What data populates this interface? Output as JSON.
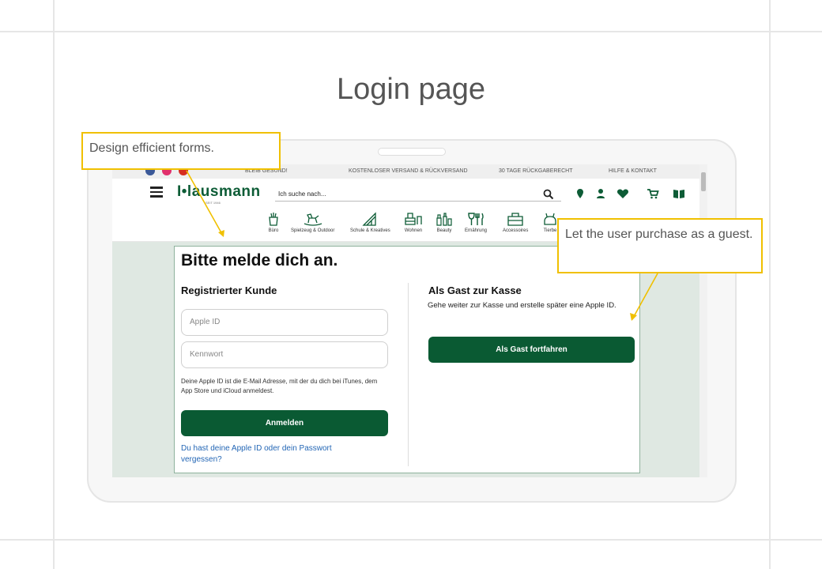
{
  "slide": {
    "title": "Login page"
  },
  "callouts": {
    "forms": "Design efficient forms.",
    "guest": "Let the user purchase as a guest."
  },
  "topbar": {
    "items": [
      "BLEIB GESUND!",
      "KOSTENLOSER VERSAND & RÜCKVERSAND",
      "30 TAGE RÜCKGABERECHT",
      "HILFE & KONTAKT"
    ]
  },
  "header": {
    "logo": "I•lausmann",
    "logo_sub": "SEIT 1946",
    "search_placeholder": "Ich suche nach..."
  },
  "categories": [
    "Büro",
    "Spielzeug & Outdoor",
    "Schule & Kreatives",
    "Wohnen",
    "Beauty",
    "Ernährung",
    "Accessoires",
    "Tierbe"
  ],
  "login": {
    "heading": "Bitte melde dich an.",
    "registered": {
      "title": "Registrierter Kunde",
      "apple_id_placeholder": "Apple ID",
      "password_placeholder": "Kennwort",
      "hint": "Deine Apple ID ist die E-Mail Adresse, mit der du dich bei iTunes, dem App Store und iCloud anmeldest.",
      "submit": "Anmelden",
      "forgot_link": "Du hast deine Apple ID oder dein Passwort vergessen?"
    },
    "guest": {
      "title": "Als Gast zur Kasse",
      "text": "Gehe weiter zur Kasse und erstelle später eine Apple ID.",
      "button": "Als Gast fortfahren"
    }
  },
  "colors": {
    "brand_green": "#0a5a33",
    "link_blue": "#2366b5",
    "callout_yellow": "#f0c000"
  }
}
